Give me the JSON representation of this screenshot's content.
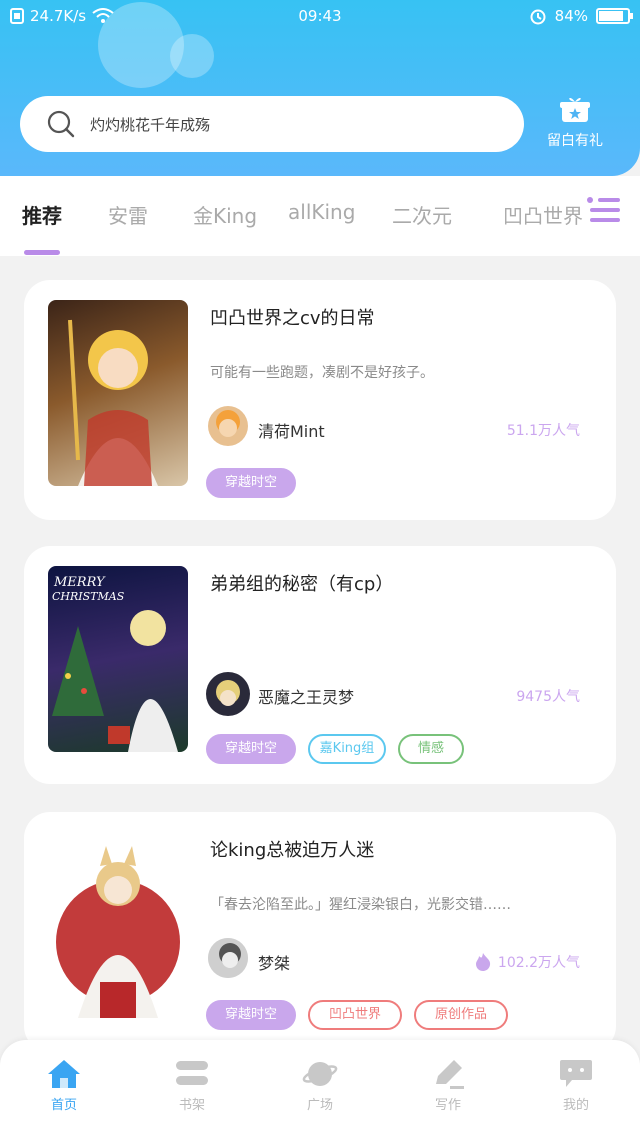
{
  "status_bar": {
    "speed": "24.7K/s",
    "time": "09:43",
    "battery": "84%",
    "battery_level": 0.84
  },
  "search": {
    "placeholder": "灼灼桃花千年成殇"
  },
  "gift": {
    "label": "留白有礼"
  },
  "tabs": [
    {
      "label": "推荐",
      "active": true
    },
    {
      "label": "安雷"
    },
    {
      "label": "金King"
    },
    {
      "label": "allKing"
    },
    {
      "label": "二次元"
    },
    {
      "label": "凹凸世界"
    }
  ],
  "cards": [
    {
      "title": "凹凸世界之cv的日常",
      "desc": "可能有一些跑题，凑剧不是好孩子。",
      "author": "清荷Mint",
      "popularity": "51.1万人气",
      "tags": [
        {
          "label": "穿越时空",
          "style": "fill"
        }
      ]
    },
    {
      "title": "弟弟组的秘密（有cp）",
      "desc": "",
      "author": "恶魔之王灵梦",
      "popularity": "9475人气",
      "tags": [
        {
          "label": "穿越时空",
          "style": "fill"
        },
        {
          "label": "嘉King组",
          "style": "blue"
        },
        {
          "label": "情感",
          "style": "green"
        }
      ]
    },
    {
      "title": "论king总被迫万人迷",
      "desc": "「春去沦陷至此。」猩红浸染银白，光影交错……",
      "author": "梦桀",
      "popularity": "102.2万人气",
      "tags": [
        {
          "label": "穿越时空",
          "style": "fill"
        },
        {
          "label": "凹凸世界",
          "style": "red"
        },
        {
          "label": "原创作品",
          "style": "red"
        }
      ]
    }
  ],
  "bottom_nav": [
    {
      "label": "首页",
      "icon": "home-icon",
      "active": true
    },
    {
      "label": "书架",
      "icon": "bookshelf-icon"
    },
    {
      "label": "广场",
      "icon": "planet-icon"
    },
    {
      "label": "写作",
      "icon": "pencil-icon"
    },
    {
      "label": "我的",
      "icon": "chat-bubble-icon"
    }
  ],
  "colors": {
    "header_top": "#37c2f3",
    "accent_purple": "#c9a7ec",
    "active_blue": "#3aa5f2"
  }
}
